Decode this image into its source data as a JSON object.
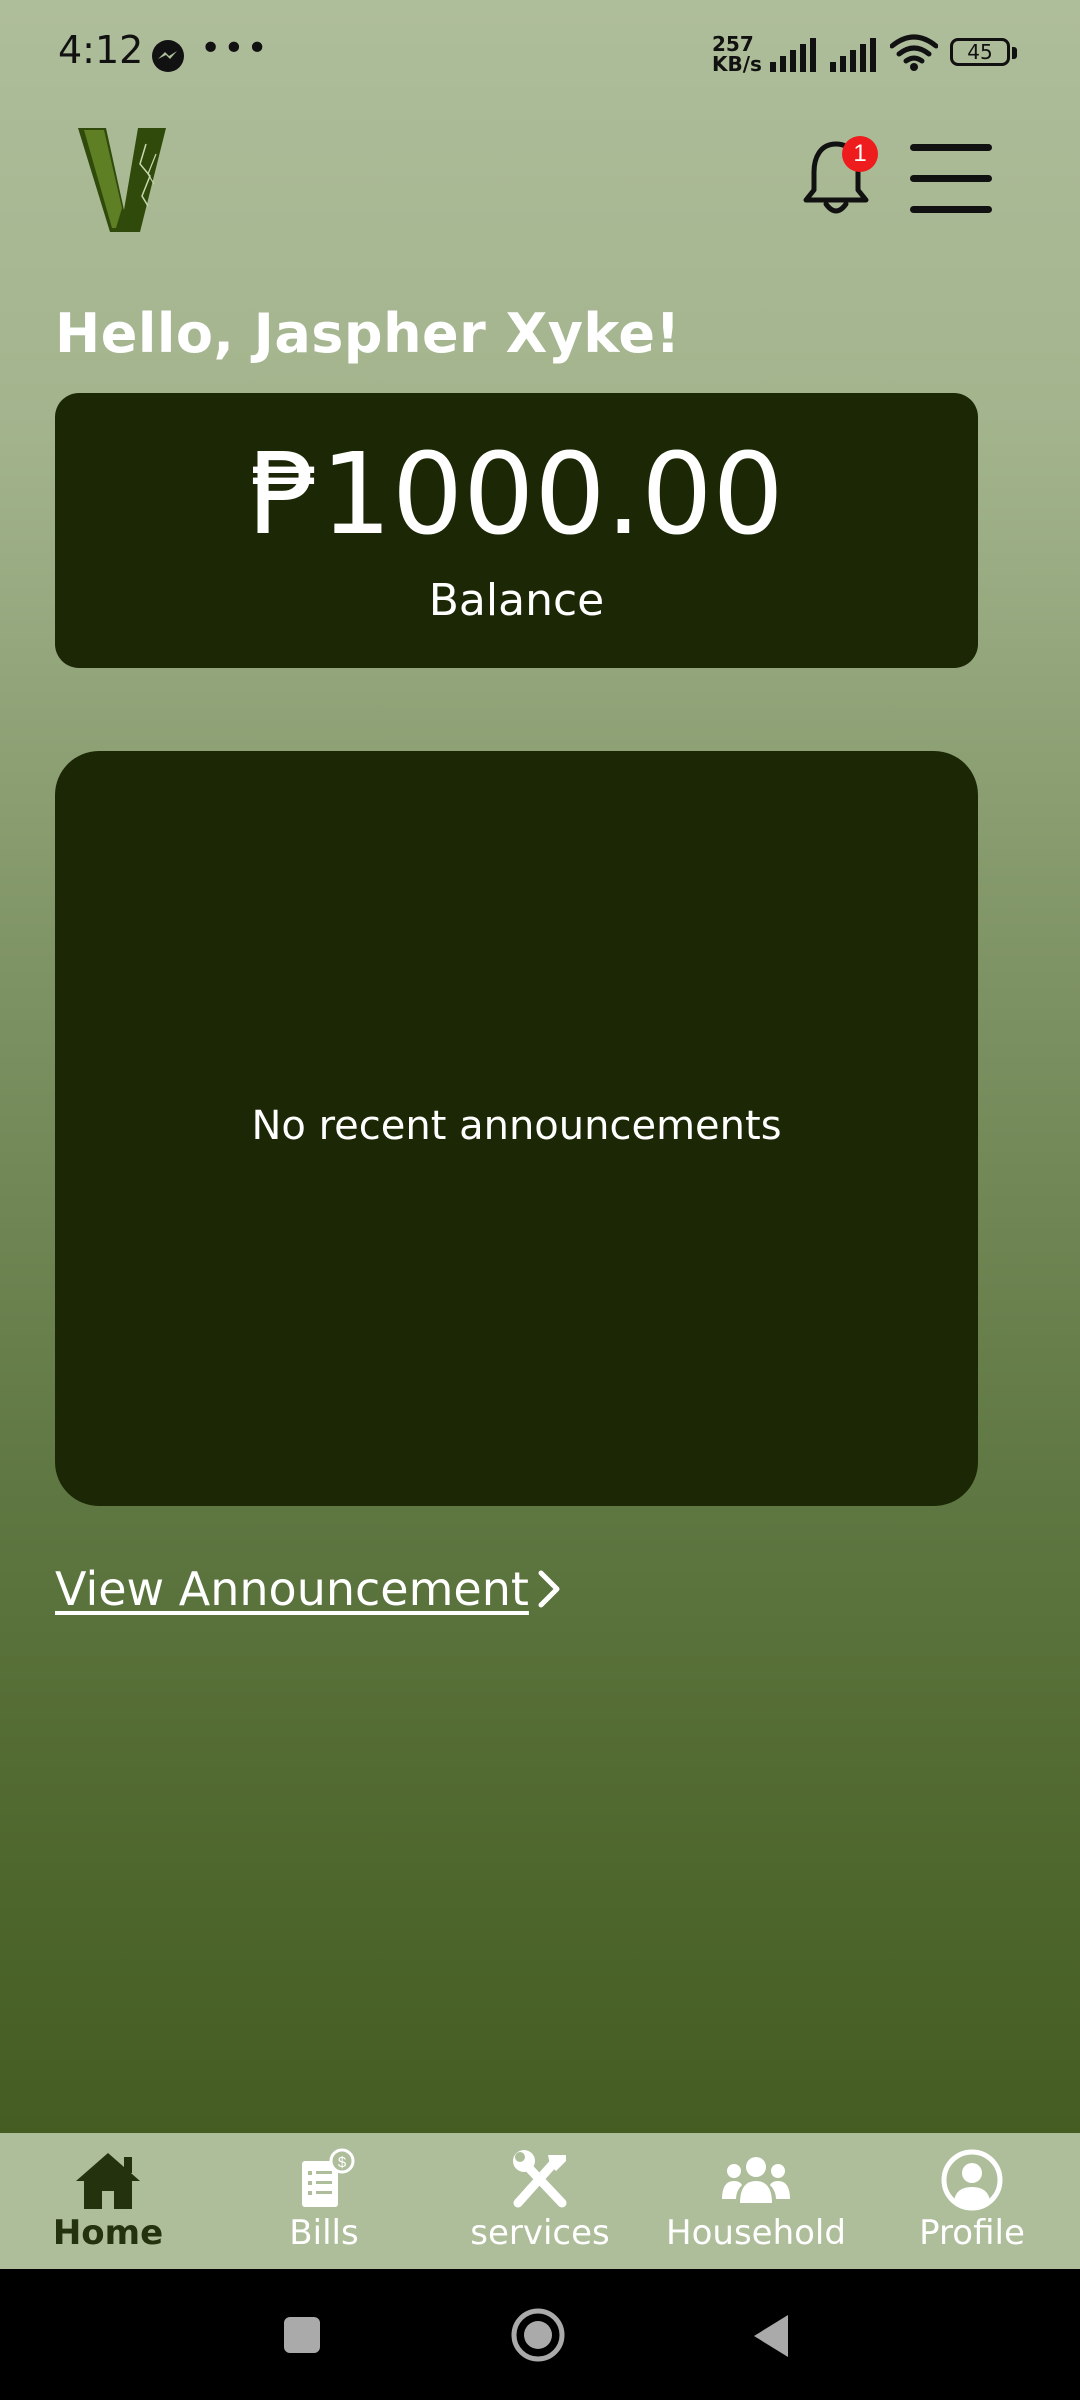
{
  "status_bar": {
    "time": "4:12",
    "speed_value": "257",
    "speed_unit": "KB/s",
    "battery": "45",
    "icons": [
      "messenger-icon",
      "more-dots-icon",
      "signal-icon",
      "signal-icon",
      "wifi-icon",
      "battery-icon"
    ]
  },
  "header": {
    "notification_count": "1",
    "icons": [
      "app-logo",
      "bell-icon",
      "hamburger-menu-icon"
    ]
  },
  "greeting": "Hello, Jaspher Xyke!",
  "balance": {
    "amount": "₱1000.00",
    "label": "Balance"
  },
  "announcements": {
    "empty_text": "No recent announcements",
    "link_label": "View Announcement"
  },
  "bottom_nav": {
    "items": [
      {
        "label": "Home",
        "icon": "home-icon",
        "active": true
      },
      {
        "label": "Bills",
        "icon": "bill-icon",
        "active": false
      },
      {
        "label": "services",
        "icon": "tools-icon",
        "active": false
      },
      {
        "label": "Household",
        "icon": "people-icon",
        "active": false
      },
      {
        "label": "Profile",
        "icon": "user-circle-icon",
        "active": false
      }
    ]
  },
  "colors": {
    "card": "#1c2805",
    "nav_bg": "#aebd9a",
    "active": "#24330d",
    "badge": "#ee1c1c"
  }
}
